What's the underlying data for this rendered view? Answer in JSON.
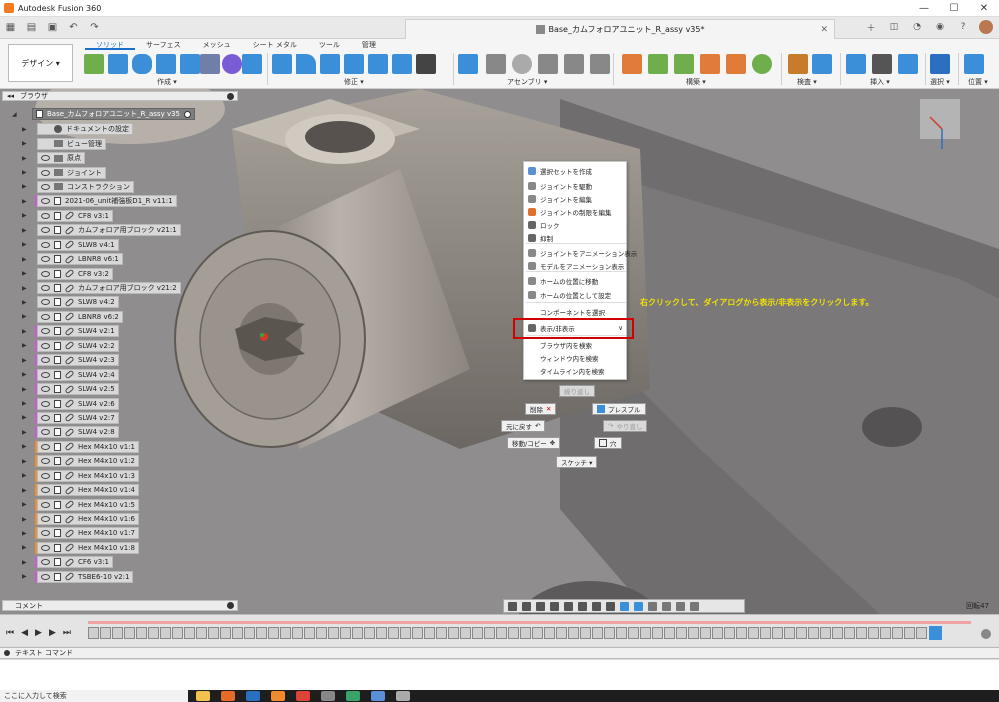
{
  "window": {
    "title": "Autodesk Fusion 360",
    "minimize": "—",
    "maximize": "☐",
    "close": "✕"
  },
  "document_tab": {
    "title": "Base_カムフォロアユニット_R_assy v35*",
    "close": "✕"
  },
  "ribbon": {
    "workspace_button": "デザイン ▾",
    "tabs": [
      "ソリッド",
      "サーフェス",
      "メッシュ",
      "シート メタル",
      "ツール",
      "管理"
    ],
    "active_tab": "ソリッド",
    "groups": [
      "作成 ▾",
      "修正 ▾",
      "アセンブリ ▾",
      "構築 ▾",
      "検査 ▾",
      "挿入 ▾",
      "選択 ▾",
      "位置 ▾"
    ]
  },
  "browser": {
    "header": "ブラウザ",
    "root": "Base_カムフォロアユニット_R_assy v35",
    "items": [
      {
        "label": "ドキュメントの設定",
        "icon": "gear-icon",
        "eye": false,
        "stripe": ""
      },
      {
        "label": "ビュー管理",
        "icon": "folder-icon",
        "eye": false,
        "stripe": ""
      },
      {
        "label": "原点",
        "icon": "folder-icon",
        "eye": true,
        "stripe": ""
      },
      {
        "label": "ジョイント",
        "icon": "folder-icon",
        "eye": true,
        "stripe": ""
      },
      {
        "label": "コンストラクション",
        "icon": "folder-icon",
        "eye": true,
        "stripe": ""
      },
      {
        "label": "2021-06_unit補強板D1_R v11:1",
        "icon": "doc-icon",
        "eye": true,
        "stripe": "#c85bd6"
      },
      {
        "label": "CF8 v3:1",
        "icon": "link-icon",
        "eye": true,
        "stripe": ""
      },
      {
        "label": "カムフォロア用ブロック v21:1",
        "icon": "link-icon",
        "eye": true,
        "stripe": ""
      },
      {
        "label": "SLW8 v4:1",
        "icon": "link-icon",
        "eye": true,
        "stripe": ""
      },
      {
        "label": "LBNR8 v6:1",
        "icon": "link-icon",
        "eye": true,
        "stripe": ""
      },
      {
        "label": "CF8 v3:2",
        "icon": "link-icon",
        "eye": true,
        "stripe": ""
      },
      {
        "label": "カムフォロア用ブロック v21:2",
        "icon": "link-icon",
        "eye": true,
        "stripe": ""
      },
      {
        "label": "SLW8 v4:2",
        "icon": "link-icon",
        "eye": true,
        "stripe": ""
      },
      {
        "label": "LBNR8 v6:2",
        "icon": "link-icon",
        "eye": true,
        "stripe": ""
      },
      {
        "label": "SLW4 v2:1",
        "icon": "link-icon",
        "eye": true,
        "stripe": "#c85bd6"
      },
      {
        "label": "SLW4 v2:2",
        "icon": "link-icon",
        "eye": true,
        "stripe": "#c85bd6"
      },
      {
        "label": "SLW4 v2:3",
        "icon": "link-icon",
        "eye": true,
        "stripe": "#c85bd6"
      },
      {
        "label": "SLW4 v2:4",
        "icon": "link-icon",
        "eye": true,
        "stripe": "#c85bd6"
      },
      {
        "label": "SLW4 v2:5",
        "icon": "link-icon",
        "eye": true,
        "stripe": "#c85bd6"
      },
      {
        "label": "SLW4 v2:6",
        "icon": "link-icon",
        "eye": true,
        "stripe": "#c85bd6"
      },
      {
        "label": "SLW4 v2:7",
        "icon": "link-icon",
        "eye": true,
        "stripe": "#c85bd6"
      },
      {
        "label": "SLW4 v2:8",
        "icon": "link-icon",
        "eye": true,
        "stripe": "#c85bd6"
      },
      {
        "label": "Hex M4x10 v1:1",
        "icon": "link-icon",
        "eye": true,
        "stripe": "#f0902c"
      },
      {
        "label": "Hex M4x10 v1:2",
        "icon": "link-icon",
        "eye": true,
        "stripe": "#f0902c"
      },
      {
        "label": "Hex M4x10 v1:3",
        "icon": "link-icon",
        "eye": true,
        "stripe": "#f0902c"
      },
      {
        "label": "Hex M4x10 v1:4",
        "icon": "link-icon",
        "eye": true,
        "stripe": "#f0902c"
      },
      {
        "label": "Hex M4x10 v1:5",
        "icon": "link-icon",
        "eye": true,
        "stripe": "#f0902c"
      },
      {
        "label": "Hex M4x10 v1:6",
        "icon": "link-icon",
        "eye": true,
        "stripe": "#f0902c"
      },
      {
        "label": "Hex M4x10 v1:7",
        "icon": "link-icon",
        "eye": true,
        "stripe": "#f0902c"
      },
      {
        "label": "Hex M4x10 v1:8",
        "icon": "link-icon",
        "eye": true,
        "stripe": "#f0902c"
      },
      {
        "label": "CF6 v3:1",
        "icon": "link-icon",
        "eye": true,
        "stripe": "#c85bd6"
      },
      {
        "label": "TSBE6-10 v2:1",
        "icon": "link-icon",
        "eye": true,
        "stripe": "#c85bd6"
      }
    ]
  },
  "context_menu": {
    "items": [
      {
        "label": "選択セットを作成",
        "color": "#5a8fd0"
      },
      {
        "label": "ジョイントを駆動",
        "color": "#888888"
      },
      {
        "label": "ジョイントを編集",
        "color": "#888888"
      },
      {
        "label": "ジョイントの制限を編集",
        "color": "#e07030"
      },
      {
        "label": "ロック",
        "color": "#666666"
      },
      {
        "label": "抑制",
        "color": "#666666"
      },
      {
        "label": "ジョイントをアニメーション表示",
        "color": "#888888"
      },
      {
        "label": "モデルをアニメーション表示",
        "color": "#888888"
      },
      {
        "label": "ホームの位置に移動",
        "color": "#888888"
      },
      {
        "label": "ホームの位置として設定",
        "color": "#888888"
      },
      {
        "label": "コンポーネントを選択",
        "color": ""
      },
      {
        "label": "表示/非表示",
        "color": "#666666",
        "submenu": "∨"
      },
      {
        "label": "ブラウザ内を検索",
        "color": ""
      },
      {
        "label": "ウィンドウ内を検索",
        "color": ""
      },
      {
        "label": "タイムライン内を検索",
        "color": ""
      }
    ]
  },
  "annotation": "右クリックして、ダイアログから表示/非表示をクリックします。",
  "marking_menu": {
    "repeat": "繰り返し",
    "delete": "削除",
    "presspull": "プレスプル",
    "undo": "元に戻す",
    "redo": "やり直し",
    "move_copy": "移動/コピー",
    "hole": "穴",
    "sketch": "スケッチ ▾"
  },
  "comment_panel": "コメント",
  "rotation_label": "回転47",
  "text_command": "テキスト コマンド",
  "taskbar_search": "ここに入力して検索",
  "colors": {
    "accent": "#1b6fc8",
    "highlight": "#d20000",
    "annotation": "#f2e300"
  }
}
